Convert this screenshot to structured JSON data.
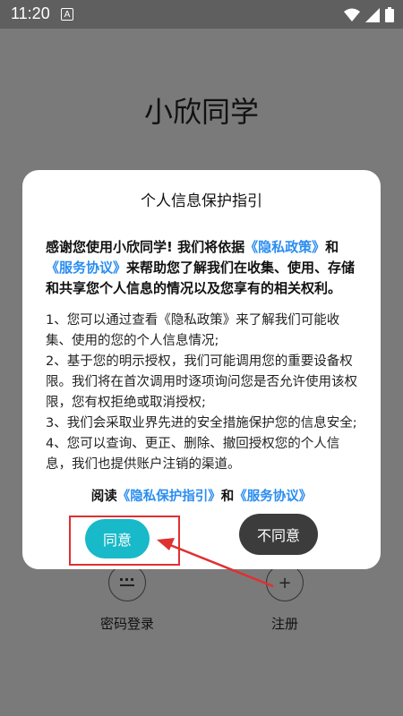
{
  "status_bar": {
    "time": "11:20",
    "notification_letter": "A"
  },
  "app": {
    "title": "小欣同学",
    "bottom_actions": [
      {
        "label": "密码登录",
        "icon": "keypad-icon"
      },
      {
        "label": "注册",
        "icon": "plus-icon"
      }
    ]
  },
  "dialog": {
    "title": "个人信息保护指引",
    "intro_prefix": "感谢您使用小欣同学! 我们将依据",
    "intro_link1": "《隐私政策》",
    "intro_and": "和",
    "intro_link2": "《服务协议》",
    "intro_suffix": "来帮助您了解我们在收集、使用、存储和共享您个人信息的情况以及您享有的相关权利。",
    "items": [
      "1、您可以通过查看《隐私政策》来了解我们可能收集、使用的您的个人信息情况;",
      "2、基于您的明示授权，我们可能调用您的重要设备权限。我们将在首次调用时逐项询问您是否允许使用该权限，您有权拒绝或取消授权;",
      "3、我们会采取业界先进的安全措施保护您的信息安全;",
      "4、您可以查询、更正、删除、撤回授权您的个人信息，我们也提供账户注销的渠道。"
    ],
    "footer_prefix": "阅读",
    "footer_link1": "《隐私保护指引》",
    "footer_and": "和",
    "footer_link2": "《服务协议》",
    "agree_label": "同意",
    "disagree_label": "不同意"
  },
  "colors": {
    "link": "#2a8df0",
    "agree": "#18b9c8",
    "disagree": "#3c3c3c",
    "annotation": "#e03030"
  }
}
